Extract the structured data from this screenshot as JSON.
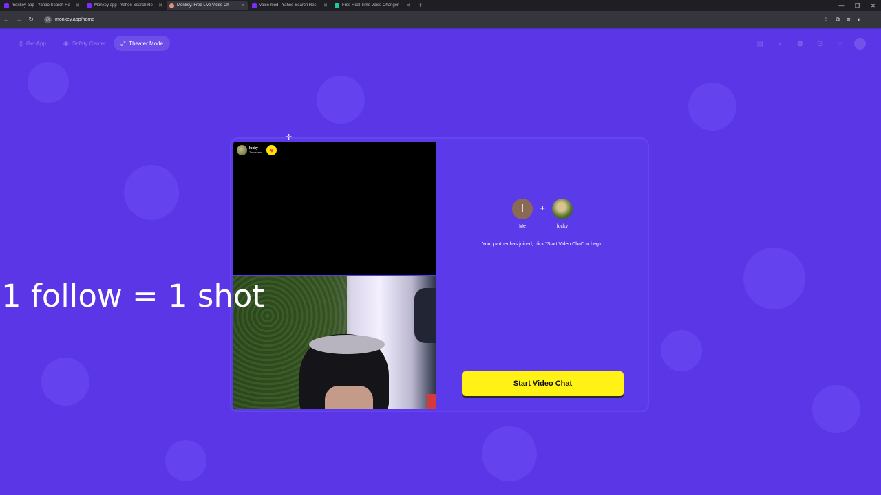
{
  "browser": {
    "tabs": [
      {
        "title": "monkey app - Yahoo Search Re",
        "favicon": "yahoo-icon",
        "active": false
      },
      {
        "title": "Monkey app - Yahoo Search Re",
        "favicon": "yahoo-icon",
        "active": false
      },
      {
        "title": "Monkey: Free Live Video Ch",
        "favicon": "monkey-icon",
        "active": true
      },
      {
        "title": "voice mod - Yahoo Search Res",
        "favicon": "yahoo-icon",
        "active": false
      },
      {
        "title": "Free Real Time Voice Changer",
        "favicon": "voice-icon",
        "active": false
      }
    ],
    "url": "monkey.app/home"
  },
  "header": {
    "get_app": "Get App",
    "safety_center": "Safety Center",
    "theater_mode": "Theater Mode"
  },
  "video": {
    "partner_name": "lucky",
    "partner_subtitle": "Tennessee"
  },
  "overlay_text": "1 follow = 1 shot",
  "match": {
    "me_initial": "I",
    "me_label": "Me",
    "plus": "+",
    "partner_label": "lucky",
    "status": "Your partner has joined, click \"Start Video Chat\" to begin",
    "start_button": "Start Video Chat"
  },
  "colors": {
    "background": "#5a36e6",
    "button": "#fff214",
    "heart": "#ffe400"
  }
}
